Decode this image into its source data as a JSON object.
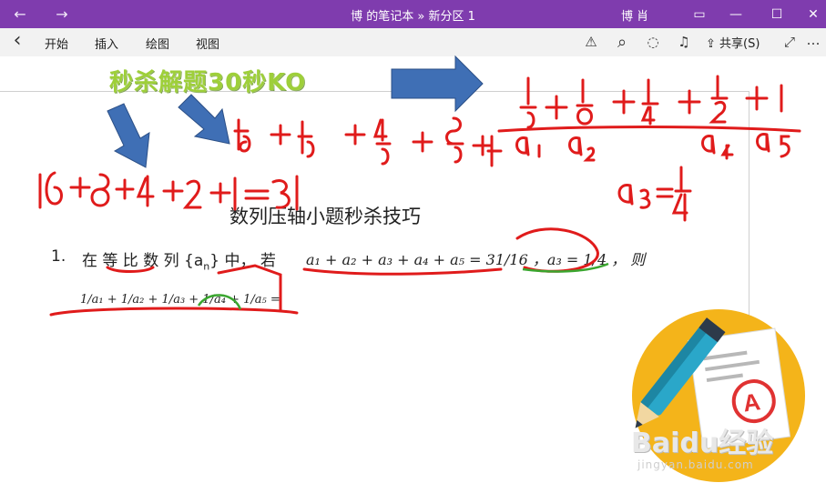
{
  "titlebar": {
    "back_icon": "←",
    "forward_icon": "→",
    "title": "博 的笔记本 » 新分区 1",
    "user": "博 肖",
    "restore_icon": "▭",
    "minimize_icon": "—",
    "maximize_icon": "☐",
    "close_icon": "✕",
    "color": "#7f3cae"
  },
  "ribbon": {
    "back_icon": "‹",
    "tabs": [
      "开始",
      "插入",
      "绘图",
      "视图"
    ],
    "share_label": "共享(S)",
    "more_icon": "…",
    "expand_icon": "⤢",
    "warning_icon": "⚠",
    "search_icon": "⌕",
    "lightbulb_icon": "◌",
    "bell_icon": "♫"
  },
  "document": {
    "overlay_caption": "秒杀解题30秒KO",
    "title": "数列压轴小题秒杀技巧",
    "question": {
      "number": "1.",
      "text_before": "在 等 比 数 列 {a",
      "text_sub": "n",
      "text_after": "} 中， 若",
      "condition": "a₁ + a₂ + a₃ + a₄ + a₅ = 31/16 ，a₃ = 1/4 ， 则",
      "expression": "1/a₁ + 1/a₂ + 1/a₃ + 1/a₄ + 1/a₅ ="
    },
    "handwriting": {
      "fractions_top": "1/16 + 2/16 + 4/16 + 8/16 + 16/16",
      "sum_line": "16+8+4+2+1=31",
      "series_right": "1/16 + 1/8 + 1/4 + 1/2 + 1",
      "labels": [
        "a₁",
        "a₂",
        "a₄",
        "a₅"
      ],
      "a3_value": "a₃ = 1/4",
      "answer": "31"
    },
    "ink_color": "#e01b1b",
    "highlight_color": "#3aa62f"
  },
  "watermark": {
    "brand": "Baidu经验",
    "url": "jingyan.baidu.com"
  }
}
